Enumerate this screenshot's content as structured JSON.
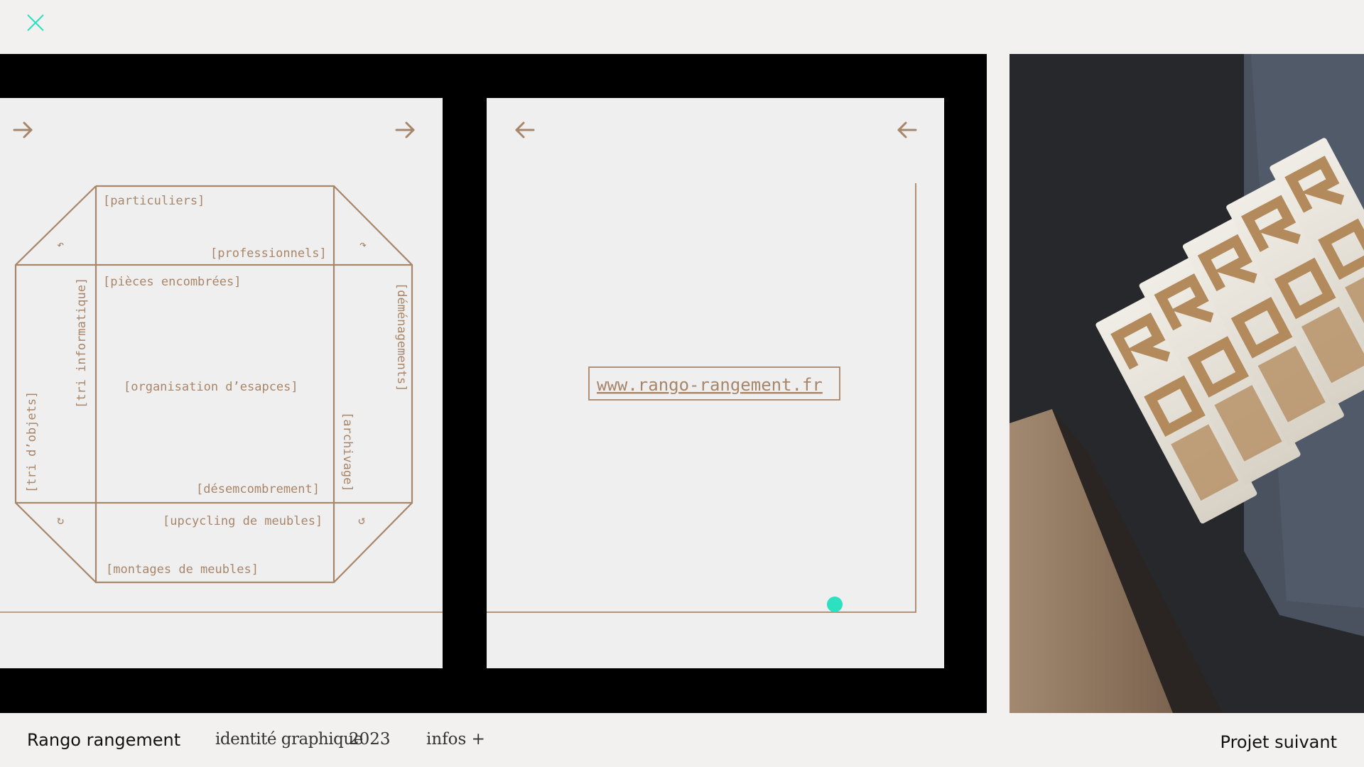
{
  "icons": {
    "close": "close-icon",
    "arrow_right": "arrow-right-icon",
    "arrow_left": "arrow-left-icon"
  },
  "colors": {
    "accent": "#2de0c0",
    "copper": "#a8866a",
    "background": "#f2f1ef",
    "slide_bg": "#000000",
    "card_bg": "#efefef"
  },
  "box_left": {
    "labels": {
      "particuliers": "[particuliers]",
      "professionnels": "[professionnels]",
      "pieces": "[pièces encombrées]",
      "tri_informatique": "[tri informatique]",
      "demenagements": "[déménagements]",
      "organisation": "[organisation d’esapces]",
      "tri_objets": "[tri d’objets]",
      "archivage": "[archivage]",
      "desencombrement": "[désemcombrement]",
      "upcycling": "[upcycling de meubles]",
      "montages": "[montages de meubles]"
    },
    "rotate_glyphs": [
      "↶",
      "↷",
      "↻",
      "↺"
    ]
  },
  "box_right": {
    "url": "www.rango-rangement.fr"
  },
  "footer": {
    "title": "Rango rangement",
    "category": "identité graphique",
    "year": "2023",
    "infos": "infos +",
    "next": "Projet suivant"
  }
}
